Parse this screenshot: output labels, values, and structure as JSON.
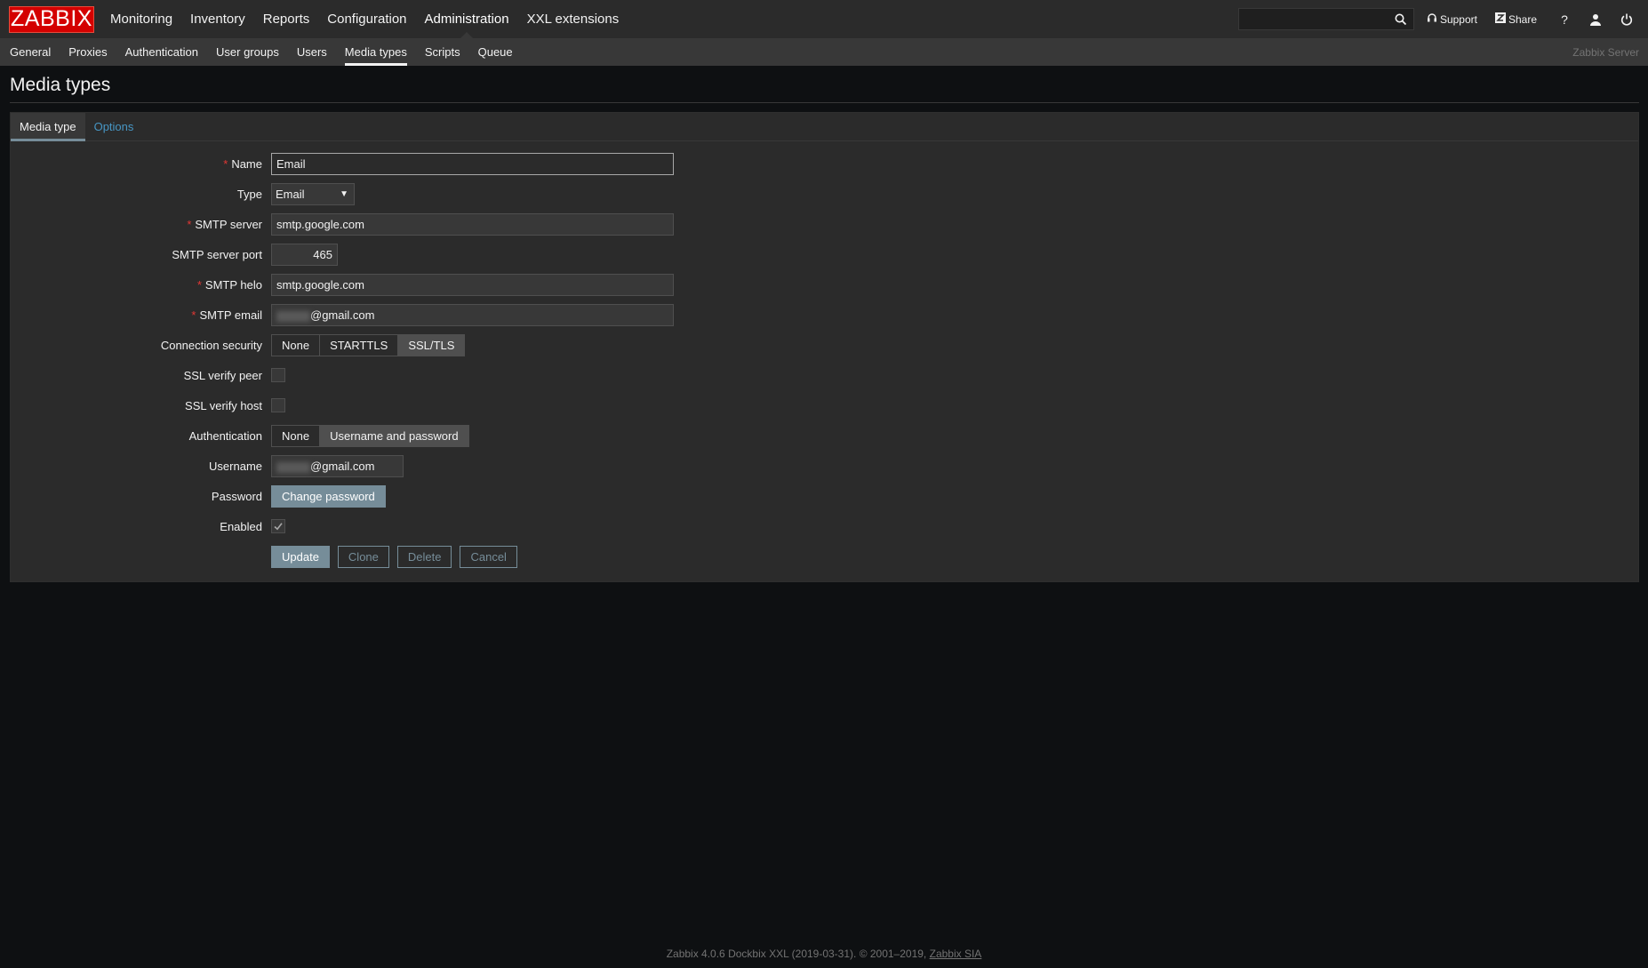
{
  "logo": "ZABBIX",
  "main_menu": [
    "Monitoring",
    "Inventory",
    "Reports",
    "Configuration",
    "Administration",
    "XXL extensions"
  ],
  "main_menu_active": "Administration",
  "top_right": {
    "search_value": "",
    "support": "Support",
    "share": "Share",
    "help": "?"
  },
  "sub_menu": [
    "General",
    "Proxies",
    "Authentication",
    "User groups",
    "Users",
    "Media types",
    "Scripts",
    "Queue"
  ],
  "sub_menu_active": "Media types",
  "server_name": "Zabbix Server",
  "page_title": "Media types",
  "tabs": [
    "Media type",
    "Options"
  ],
  "form": {
    "name": {
      "label": "Name",
      "value": "Email"
    },
    "type": {
      "label": "Type",
      "value": "Email"
    },
    "smtp_server": {
      "label": "SMTP server",
      "value": "smtp.google.com"
    },
    "smtp_port": {
      "label": "SMTP server port",
      "value": "465"
    },
    "smtp_helo": {
      "label": "SMTP helo",
      "value": "smtp.google.com"
    },
    "smtp_email": {
      "label": "SMTP email",
      "value_suffix": "@gmail.com"
    },
    "connection_security": {
      "label": "Connection security",
      "options": [
        "None",
        "STARTTLS",
        "SSL/TLS"
      ],
      "selected": "SSL/TLS"
    },
    "ssl_verify_peer": {
      "label": "SSL verify peer",
      "checked": false
    },
    "ssl_verify_host": {
      "label": "SSL verify host",
      "checked": false
    },
    "authentication": {
      "label": "Authentication",
      "options": [
        "None",
        "Username and password"
      ],
      "selected": "Username and password"
    },
    "username": {
      "label": "Username",
      "value_suffix": "@gmail.com"
    },
    "password": {
      "label": "Password",
      "button": "Change password"
    },
    "enabled": {
      "label": "Enabled",
      "checked": true
    }
  },
  "buttons": {
    "update": "Update",
    "clone": "Clone",
    "delete": "Delete",
    "cancel": "Cancel"
  },
  "footer": {
    "text": "Zabbix 4.0.6 Dockbix XXL (2019-03-31). © 2001–2019,",
    "link": "Zabbix SIA"
  },
  "colors": {
    "logo_red": "#d40000",
    "accent": "#768d99",
    "link": "#4796c4",
    "required": "#e33734"
  }
}
